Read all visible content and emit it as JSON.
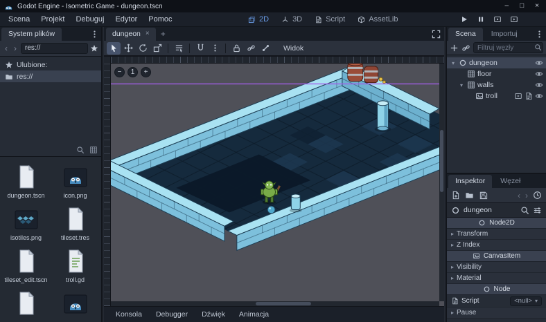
{
  "window": {
    "title": "Godot Engine - Isometric Game - dungeon.tscn",
    "minimize": "–",
    "maximize": "□",
    "close": "×"
  },
  "menubar": {
    "menus": [
      "Scena",
      "Projekt",
      "Debuguj",
      "Edytor",
      "Pomoc"
    ],
    "workspaces": [
      {
        "label": "2D",
        "icon": "i-2d",
        "active": true
      },
      {
        "label": "3D",
        "icon": "i-3d",
        "active": false
      },
      {
        "label": "Script",
        "icon": "i-scripticon",
        "active": false
      },
      {
        "label": "AssetLib",
        "icon": "i-asset",
        "active": false
      }
    ],
    "playbar": [
      {
        "name": "play-button",
        "icon": "i-play"
      },
      {
        "name": "pause-button",
        "icon": "i-pause"
      },
      {
        "name": "play-scene-button",
        "icon": "i-film"
      },
      {
        "name": "play-custom-scene-button",
        "icon": "i-film"
      }
    ]
  },
  "filesystem": {
    "title": "System plików",
    "nav": {
      "back": "‹",
      "forward": "›"
    },
    "path": "res://",
    "favorites_label": "Ulubione:",
    "root_label": "res://",
    "files": [
      {
        "name": "dungeon.tscn",
        "type": "scene"
      },
      {
        "name": "icon.png",
        "type": "image-godot"
      },
      {
        "name": "isotiles.png",
        "type": "image-tiles"
      },
      {
        "name": "tileset.tres",
        "type": "resource"
      },
      {
        "name": "tileset_edit.tscn",
        "type": "scene"
      },
      {
        "name": "troll.gd",
        "type": "script"
      }
    ],
    "partial": [
      {
        "name": "",
        "type": "scene"
      },
      {
        "name": "",
        "type": "image-godot"
      }
    ]
  },
  "scene_tabs": {
    "active": "dungeon",
    "close": "×",
    "add": "+"
  },
  "canvas": {
    "view_menu": "Widok",
    "zoom_out": "−",
    "zoom_value": "1",
    "zoom_in": "+"
  },
  "scene_panel": {
    "tabs": [
      {
        "label": "Scena",
        "active": true
      },
      {
        "label": "Importuj",
        "active": false
      }
    ],
    "filter_placeholder": "Filtruj węzły",
    "nodes": [
      {
        "name": "dungeon",
        "icon": "node2d",
        "depth": 0,
        "expand": "▾",
        "selected": true,
        "extras": false
      },
      {
        "name": "floor",
        "icon": "tilemap",
        "depth": 1,
        "expand": "",
        "selected": false,
        "extras": false
      },
      {
        "name": "walls",
        "icon": "tilemap",
        "depth": 1,
        "expand": "▾",
        "selected": false,
        "extras": false
      },
      {
        "name": "troll",
        "icon": "sprite",
        "depth": 2,
        "expand": "",
        "selected": false,
        "extras": true
      }
    ]
  },
  "inspector": {
    "tabs": [
      {
        "label": "Inspektor",
        "active": true
      },
      {
        "label": "Węzeł",
        "active": false
      }
    ],
    "object_name": "dungeon",
    "group_caret": "▸",
    "properties": [
      {
        "kind": "category",
        "label": "Node2D",
        "icon": "node2d"
      },
      {
        "kind": "group",
        "label": "Transform"
      },
      {
        "kind": "group",
        "label": "Z Index"
      },
      {
        "kind": "category",
        "label": "CanvasItem",
        "icon": "canvas"
      },
      {
        "kind": "group",
        "label": "Visibility"
      },
      {
        "kind": "group",
        "label": "Material"
      },
      {
        "kind": "category",
        "label": "Node",
        "icon": "node"
      },
      {
        "kind": "property",
        "label": "Script",
        "value": "<null>"
      },
      {
        "kind": "group",
        "label": "Pause"
      }
    ]
  },
  "bottom_bar": {
    "items": [
      "Konsola",
      "Debugger",
      "Dźwięk",
      "Animacja"
    ]
  },
  "colors": {
    "accent": "#699ce8",
    "scene_boundary": "#a35de8",
    "wall_top": "#a9e2f2",
    "wall_front": "#7dc0dc",
    "floor": "#152a3d",
    "troll_green": "#79ab48"
  }
}
